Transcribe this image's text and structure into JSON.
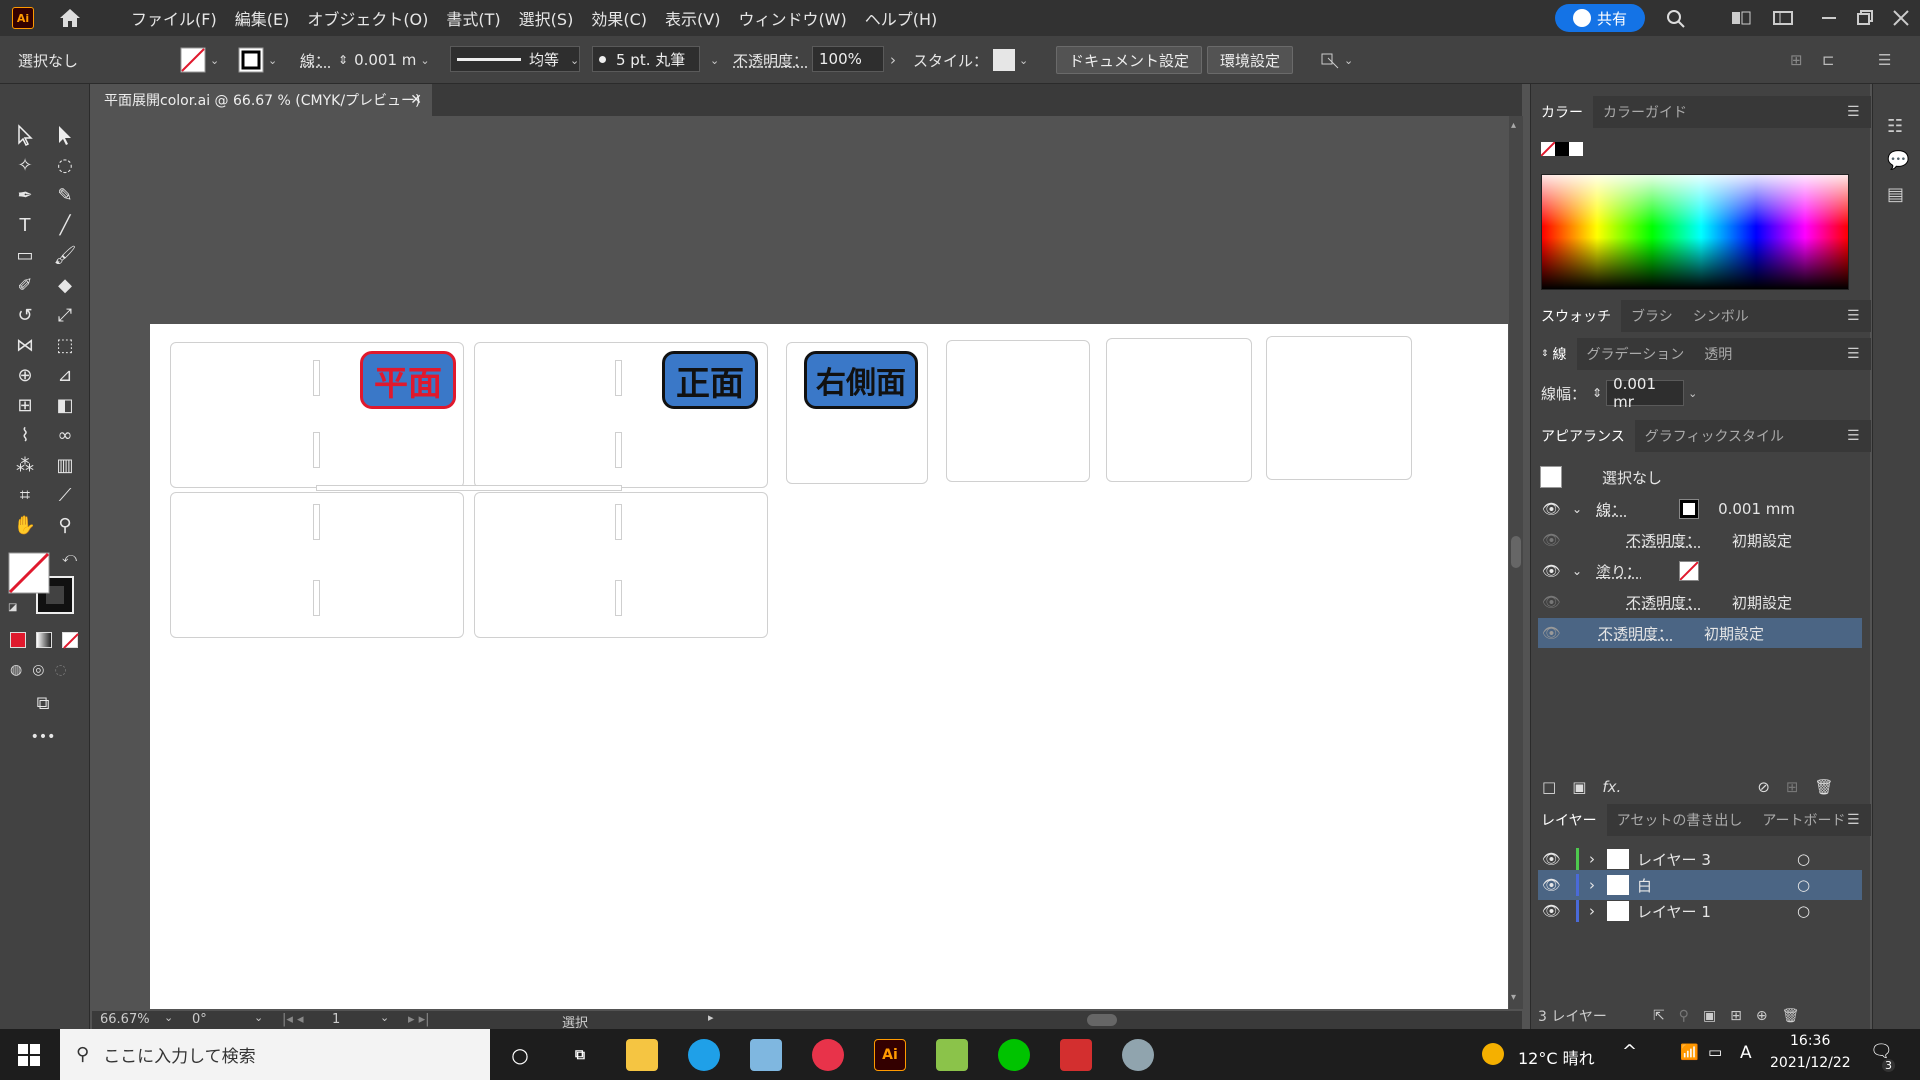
{
  "menubar": {
    "app_logo": "Ai",
    "items": [
      "ファイル(F)",
      "編集(E)",
      "オブジェクト(O)",
      "書式(T)",
      "選択(S)",
      "効果(C)",
      "表示(V)",
      "ウィンドウ(W)",
      "ヘルプ(H)"
    ],
    "share_label": "共有"
  },
  "controlbar": {
    "selection": "選択なし",
    "stroke_label": "線：",
    "stroke_value": "0.001 m",
    "profile_label": "均等",
    "brush_label": "5 pt. 丸筆",
    "opacity_label": "不透明度：",
    "opacity_value": "100%",
    "style_label": "スタイル：",
    "doc_settings": "ドキュメント設定",
    "preferences": "環境設定"
  },
  "document": {
    "tab_title": "平面展開color.ai @ 66.67 % (CMYK/プレビュー)",
    "labels": {
      "plan": "平面",
      "front": "正面",
      "right_side": "右側面"
    }
  },
  "statusbar": {
    "zoom": "66.67%",
    "rotation": "0°",
    "artboard": "1",
    "tool": "選択"
  },
  "panels": {
    "color_tabs": [
      "カラー",
      "カラーガイド"
    ],
    "swatch_tabs": [
      "スウォッチ",
      "ブラシ",
      "シンボル"
    ],
    "stroke_tabs": [
      "線",
      "グラデーション",
      "透明"
    ],
    "stroke_width_label": "線幅：",
    "stroke_width_value": "0.001 mr",
    "appearance_tabs": [
      "アピアランス",
      "グラフィックスタイル"
    ],
    "appearance": {
      "title": "選択なし",
      "stroke_label": "線：",
      "stroke_value": "0.001 mm",
      "opacity_label": "不透明度：",
      "opacity_value": "初期設定",
      "fill_label": "塗り：",
      "fill_opacity_label": "不透明度：",
      "fill_opacity_value": "初期設定",
      "global_opacity_label": "不透明度：",
      "global_opacity_value": "初期設定"
    },
    "layers_tabs": [
      "レイヤー",
      "アセットの書き出し",
      "アートボード"
    ],
    "layers": [
      {
        "name": "レイヤー 3",
        "color": "#4ec94e"
      },
      {
        "name": "白",
        "color": "#4a6ad8"
      },
      {
        "name": "レイヤー 1",
        "color": "#4a6ad8"
      }
    ],
    "layer_count": "3 レイヤー"
  },
  "taskbar": {
    "search_placeholder": "ここに入力して検索",
    "weather": "12°C 晴れ",
    "time": "16:36",
    "date": "2021/12/22",
    "notifications": "3",
    "ime": "A"
  },
  "colors": {
    "plan_fill": "#3a78c8",
    "plan_border": "#e0192d",
    "plan_text": "#e0192d",
    "label_fill": "#3a78c8",
    "share_blue": "#1473e6"
  }
}
